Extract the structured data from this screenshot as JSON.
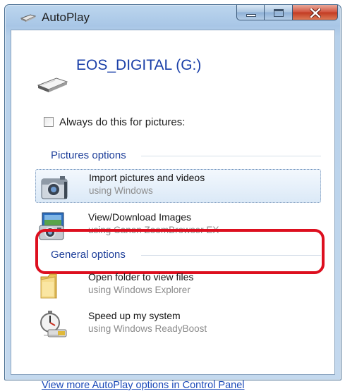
{
  "window": {
    "title": "AutoPlay"
  },
  "device": {
    "name": "EOS_DIGITAL (G:)"
  },
  "always_checkbox": {
    "label": "Always do this for pictures:",
    "checked": false
  },
  "groups": {
    "pictures": {
      "header": "Pictures options",
      "options": [
        {
          "title": "Import pictures and videos",
          "subtitle": "using Windows",
          "icon": "camera-import-icon"
        },
        {
          "title": "View/Download Images",
          "subtitle": "using Canon ZoomBrowser EX",
          "icon": "zoombrowser-camera-icon"
        }
      ]
    },
    "general": {
      "header": "General options",
      "options": [
        {
          "title": "Open folder to view files",
          "subtitle": "using Windows Explorer",
          "icon": "folder-icon"
        },
        {
          "title": "Speed up my system",
          "subtitle": "using Windows ReadyBoost",
          "icon": "readyboost-stopwatch-icon"
        }
      ]
    }
  },
  "footer": {
    "link": "View more AutoPlay options in Control Panel"
  },
  "colors": {
    "highlight": "#dd0f1f",
    "link": "#1a49b8",
    "header": "#1e3f9a"
  }
}
